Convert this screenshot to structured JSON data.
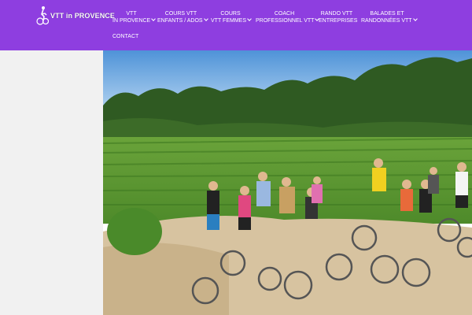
{
  "header": {
    "logo_text": "VTT in PROVENCE",
    "nav": [
      {
        "line1": "VTT",
        "line2": "IN PROVENCE",
        "dropdown": true
      },
      {
        "line1": "COURS VTT",
        "line2": "ENFANTS / ADOS",
        "dropdown": true
      },
      {
        "line1": "COURS",
        "line2": "VTT FEMMES",
        "dropdown": true
      },
      {
        "line1": "COACH",
        "line2": "PROFESSIONNEL VTT",
        "dropdown": true
      },
      {
        "line1": "RANDO VTT",
        "line2": "ENTREPRISES",
        "dropdown": false
      },
      {
        "line1": "BALADES ET",
        "line2": "RANDONNÉES VTT",
        "dropdown": true
      },
      {
        "line1": "CONTACT",
        "line2": "",
        "dropdown": false
      }
    ]
  },
  "colors": {
    "header_bg": "#8e3ee0",
    "sidebar_bg": "#f1f1f1",
    "nav_text": "#ffffff"
  },
  "icons": {
    "logo": "cyclist-icon",
    "dropdown": "chevron-down-icon"
  },
  "hero": {
    "image": "group-of-mountain-bikers-in-vineyard-photo"
  }
}
